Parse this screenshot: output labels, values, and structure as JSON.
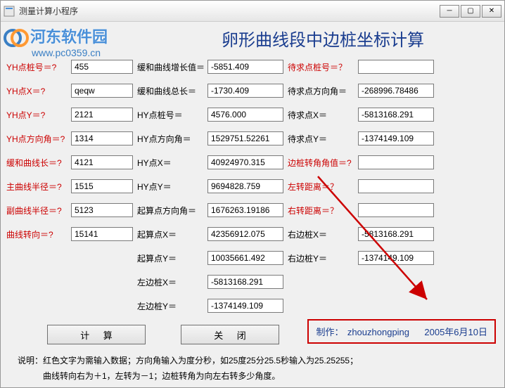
{
  "window": {
    "title": "测量计算小程序"
  },
  "watermark": {
    "site_name": "河东软件园",
    "url": "www.pc0359.cn"
  },
  "main_title": "卵形曲线段中边桩坐标计算",
  "labels": {
    "yh_stake_no": "YH点桩号＝?",
    "yh_x": "YH点X＝?",
    "yh_y": "YH点Y＝?",
    "yh_azimuth": "YH点方向角＝?",
    "spiral_len": "缓和曲线长＝?",
    "main_radius": "主曲线半径＝?",
    "sub_radius": "副曲线半径＝?",
    "curve_turn": "曲线转向＝?",
    "spiral_inc": "缓和曲线增长值＝",
    "spiral_total": "缓和曲线总长＝",
    "hy_stake_no": "HY点桩号＝",
    "hy_azimuth": "HY点方向角＝",
    "hy_x": "HY点X＝",
    "hy_y": "HY点Y＝",
    "start_azimuth": "起算点方向角＝",
    "start_x": "起算点X＝",
    "start_y": "起算点Y＝",
    "left_stake_x": "左边桩X＝",
    "left_stake_y": "左边桩Y＝",
    "target_stake": "待求点桩号＝？",
    "target_azimuth": "待求点方向角＝",
    "target_x": "待求点X＝",
    "target_y": "待求点Y＝",
    "side_turn": "边桩转角角值＝?",
    "left_dist": "左转距离＝？",
    "right_dist": "右转距离＝？",
    "right_stake_x": "右边桩X＝",
    "right_stake_y": "右边桩Y＝"
  },
  "values": {
    "yh_stake_no": "455",
    "yh_x": "qeqw",
    "yh_y": "2121",
    "yh_azimuth": "1314",
    "spiral_len": "4121",
    "main_radius": "1515",
    "sub_radius": "5123",
    "curve_turn": "15141",
    "spiral_inc": "-5851.409",
    "spiral_total": "-1730.409",
    "hy_stake_no": "4576.000",
    "hy_azimuth": "1529751.52261",
    "hy_x": "40924970.315",
    "hy_y": "9694828.759",
    "start_azimuth": "1676263.19186",
    "start_x": "42356912.075",
    "start_y": "10035661.492",
    "left_stake_x": "-5813168.291",
    "left_stake_y": "-1374149.109",
    "target_stake": "",
    "target_azimuth": "-268996.78486",
    "target_x": "-5813168.291",
    "target_y": "-1374149.109",
    "side_turn": "",
    "left_dist": "",
    "right_dist": "",
    "right_stake_x": "-5813168.291",
    "right_stake_y": "-1374149.109"
  },
  "buttons": {
    "calculate": "计 算",
    "close": "关 闭"
  },
  "author": {
    "label": "制作：",
    "name": "zhouzhongping",
    "date": "2005年6月10日"
  },
  "note": {
    "line1": "说明：红色文字为需输入数据；方向角输入为度分秒，如25度25分25.5秒输入为25.25255；",
    "line2": "　　　曲线转向右为＋1，左转为－1；边桩转角为向左右转多少角度。"
  }
}
